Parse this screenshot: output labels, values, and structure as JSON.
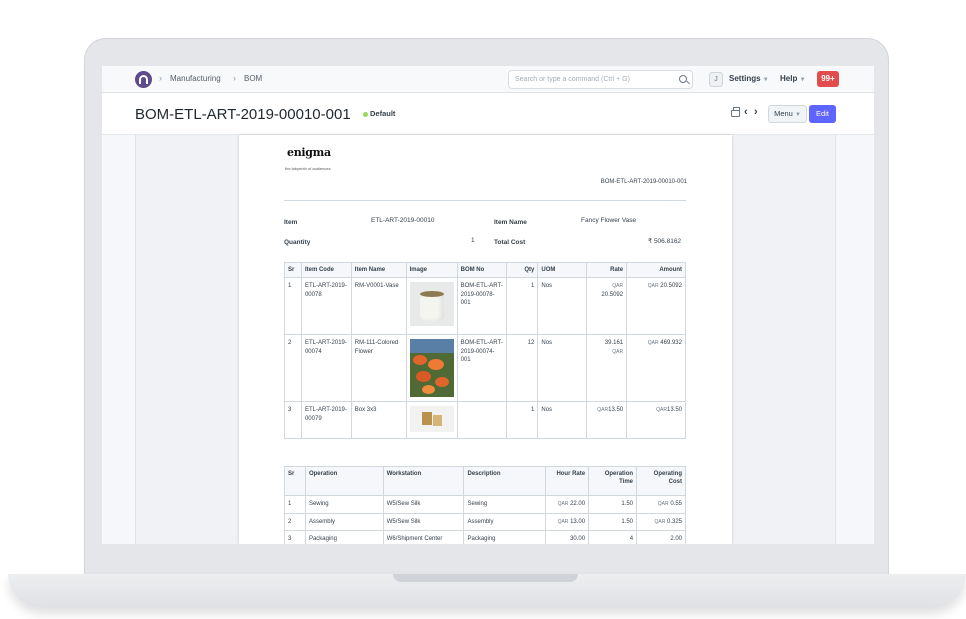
{
  "navbar": {
    "breadcrumbs": [
      "Manufacturing",
      "BOM"
    ],
    "search_placeholder": "Search or type a command (Ctrl + G)",
    "avatar_initial": "J",
    "settings_label": "Settings",
    "help_label": "Help",
    "notifications_count": "99+"
  },
  "page": {
    "title": "BOM-ETL-ART-2019-00010-001",
    "status": "Default",
    "menu_label": "Menu",
    "edit_label": "Edit"
  },
  "document": {
    "brand": "enigma",
    "tagline": "the labyrinth of audiences",
    "doc_number": "BOM-ETL-ART-2019-00010-001",
    "fields": {
      "item_label": "Item",
      "item_value": "ETL-ART-2019-00010",
      "item_name_label": "Item Name",
      "item_name_value": "Fancy Flower Vase",
      "quantity_label": "Quantity",
      "quantity_value": "1",
      "total_cost_label": "Total Cost",
      "total_cost_value": "₹ 506.8162"
    },
    "items_table": {
      "headers": [
        "Sr",
        "Item Code",
        "Item Name",
        "Image",
        "BOM No",
        "Qty",
        "UOM",
        "Rate",
        "Amount"
      ],
      "rows": [
        {
          "sr": "1",
          "item_code": "ETL-ART-2019-00078",
          "item_name": "RM-V0001-Vase",
          "bom_no": "BOM-ETL-ART-2019-00078-001",
          "qty": "1",
          "uom": "Nos",
          "rate_currency": "QAR",
          "rate": "20.5092",
          "amount_currency": "QAR",
          "amount": "20.5092",
          "image": "vase-image"
        },
        {
          "sr": "2",
          "item_code": "ETL-ART-2019-00074",
          "item_name": "RM-111-Colored Flower",
          "bom_no": "BOM-ETL-ART-2019-00074-001",
          "qty": "12",
          "uom": "Nos",
          "rate_currency": "QAR",
          "rate": "39.161",
          "amount_currency": "QAR",
          "amount": "469.932",
          "image": "flower-image"
        },
        {
          "sr": "3",
          "item_code": "ETL-ART-2019-00079",
          "item_name": "Box 3x3",
          "bom_no": "",
          "qty": "1",
          "uom": "Nos",
          "rate_currency": "QAR",
          "rate": "13.50",
          "amount_currency": "QAR",
          "amount": "13.50",
          "image": "box-image"
        }
      ]
    },
    "operations_table": {
      "headers": [
        "Sr",
        "Operation",
        "Workstation",
        "Description",
        "Hour Rate",
        "Operation Time",
        "Operating Cost"
      ],
      "rows": [
        {
          "sr": "1",
          "operation": "Sewing",
          "workstation": "W5/Sew Silk",
          "description": "Sewing",
          "hour_rate_currency": "QAR",
          "hour_rate": "22.00",
          "time": "1.50",
          "cost_currency": "QAR",
          "cost": "0.55"
        },
        {
          "sr": "2",
          "operation": "Assembly",
          "workstation": "W5/Sew Silk",
          "description": "Assembly",
          "hour_rate_currency": "QAR",
          "hour_rate": "13.00",
          "time": "1.50",
          "cost_currency": "QAR",
          "cost": "0.325"
        },
        {
          "sr": "3",
          "operation": "Packaging",
          "workstation": "W6/Shipment Center",
          "description": "Packaging",
          "hour_rate_currency": "",
          "hour_rate": "30.00",
          "time": "4",
          "cost_currency": "",
          "cost": "2.00"
        }
      ]
    }
  },
  "colors": {
    "primary": "#5e64ff",
    "badge": "#e24c4c",
    "status_dot": "#98d85b",
    "logo": "#5e4a8c"
  }
}
